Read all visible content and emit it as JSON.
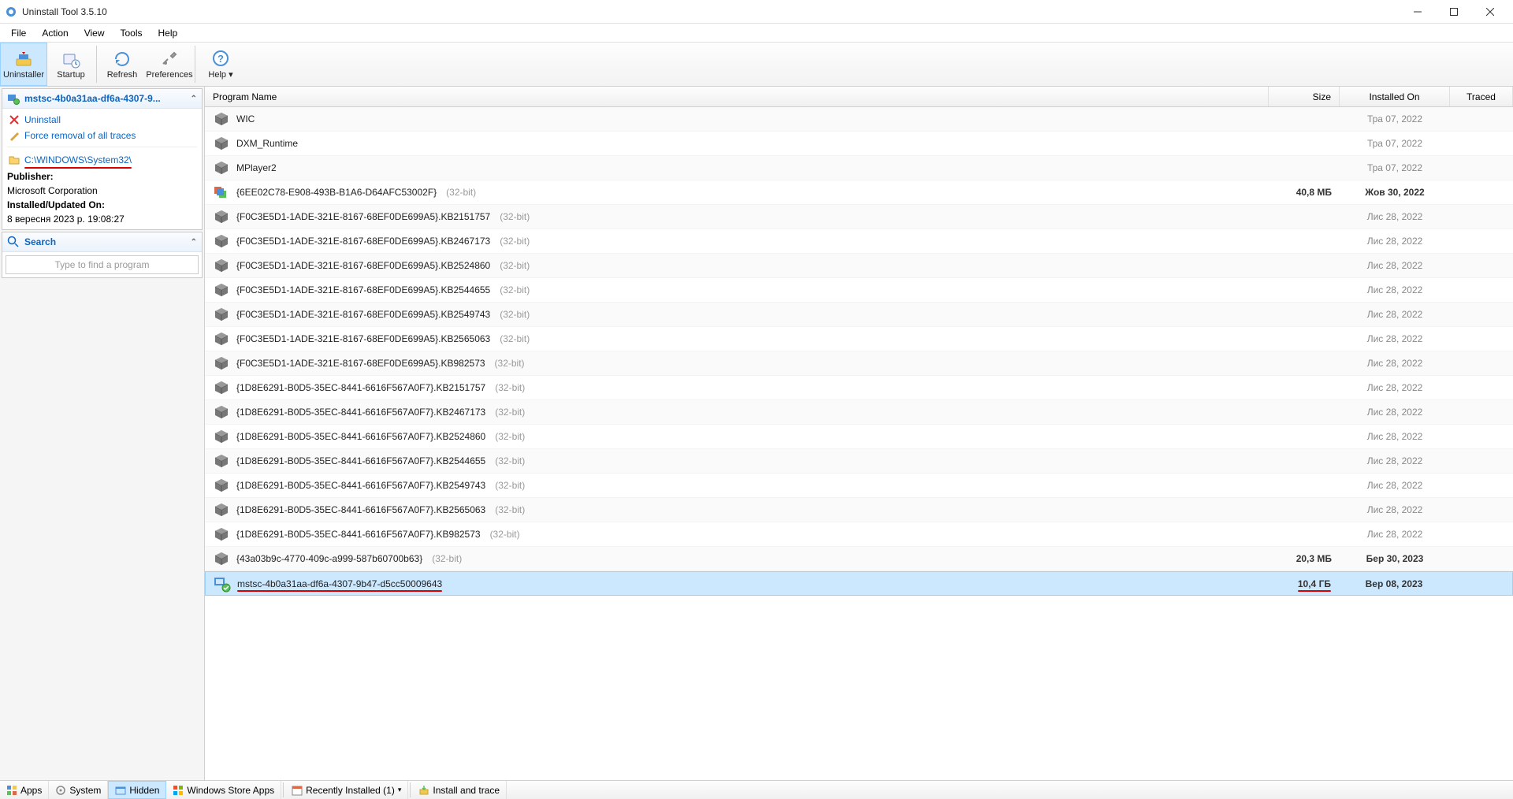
{
  "window": {
    "title": "Uninstall Tool 3.5.10"
  },
  "menu": {
    "file": "File",
    "action": "Action",
    "view": "View",
    "tools": "Tools",
    "help": "Help"
  },
  "toolbar": {
    "uninstaller": "Uninstaller",
    "startup": "Startup",
    "refresh": "Refresh",
    "preferences": "Preferences",
    "help": "Help"
  },
  "sidebar": {
    "selected_title": "mstsc-4b0a31aa-df6a-4307-9...",
    "uninstall_label": "Uninstall",
    "force_removal_label": "Force removal of all traces",
    "path": "C:\\WINDOWS\\System32\\",
    "publisher_label": "Publisher:",
    "publisher_value": "Microsoft Corporation",
    "installed_label": "Installed/Updated On:",
    "installed_value": "8 вересня 2023 р. 19:08:27",
    "search_header": "Search",
    "search_placeholder": "Type to find a program"
  },
  "columns": {
    "name": "Program Name",
    "size": "Size",
    "installed": "Installed On",
    "traced": "Traced"
  },
  "rows": [
    {
      "name": "WIC",
      "arch": "",
      "size": "",
      "installed": "Тра 07, 2022",
      "iconType": "box"
    },
    {
      "name": "DXM_Runtime",
      "arch": "",
      "size": "",
      "installed": "Тра 07, 2022",
      "iconType": "box"
    },
    {
      "name": "MPlayer2",
      "arch": "",
      "size": "",
      "installed": "Тра 07, 2022",
      "iconType": "box"
    },
    {
      "name": "{6EE02C78-E908-493B-B1A6-D64AFC53002F}",
      "arch": "(32-bit)",
      "size": "40,8 МБ",
      "installed": "Жов 30, 2022",
      "iconType": "installer",
      "bold": true
    },
    {
      "name": "{F0C3E5D1-1ADE-321E-8167-68EF0DE699A5}.KB2151757",
      "arch": "(32-bit)",
      "size": "",
      "installed": "Лис 28, 2022",
      "iconType": "box"
    },
    {
      "name": "{F0C3E5D1-1ADE-321E-8167-68EF0DE699A5}.KB2467173",
      "arch": "(32-bit)",
      "size": "",
      "installed": "Лис 28, 2022",
      "iconType": "box"
    },
    {
      "name": "{F0C3E5D1-1ADE-321E-8167-68EF0DE699A5}.KB2524860",
      "arch": "(32-bit)",
      "size": "",
      "installed": "Лис 28, 2022",
      "iconType": "box"
    },
    {
      "name": "{F0C3E5D1-1ADE-321E-8167-68EF0DE699A5}.KB2544655",
      "arch": "(32-bit)",
      "size": "",
      "installed": "Лис 28, 2022",
      "iconType": "box"
    },
    {
      "name": "{F0C3E5D1-1ADE-321E-8167-68EF0DE699A5}.KB2549743",
      "arch": "(32-bit)",
      "size": "",
      "installed": "Лис 28, 2022",
      "iconType": "box"
    },
    {
      "name": "{F0C3E5D1-1ADE-321E-8167-68EF0DE699A5}.KB2565063",
      "arch": "(32-bit)",
      "size": "",
      "installed": "Лис 28, 2022",
      "iconType": "box"
    },
    {
      "name": "{F0C3E5D1-1ADE-321E-8167-68EF0DE699A5}.KB982573",
      "arch": "(32-bit)",
      "size": "",
      "installed": "Лис 28, 2022",
      "iconType": "box"
    },
    {
      "name": "{1D8E6291-B0D5-35EC-8441-6616F567A0F7}.KB2151757",
      "arch": "(32-bit)",
      "size": "",
      "installed": "Лис 28, 2022",
      "iconType": "box"
    },
    {
      "name": "{1D8E6291-B0D5-35EC-8441-6616F567A0F7}.KB2467173",
      "arch": "(32-bit)",
      "size": "",
      "installed": "Лис 28, 2022",
      "iconType": "box"
    },
    {
      "name": "{1D8E6291-B0D5-35EC-8441-6616F567A0F7}.KB2524860",
      "arch": "(32-bit)",
      "size": "",
      "installed": "Лис 28, 2022",
      "iconType": "box"
    },
    {
      "name": "{1D8E6291-B0D5-35EC-8441-6616F567A0F7}.KB2544655",
      "arch": "(32-bit)",
      "size": "",
      "installed": "Лис 28, 2022",
      "iconType": "box"
    },
    {
      "name": "{1D8E6291-B0D5-35EC-8441-6616F567A0F7}.KB2549743",
      "arch": "(32-bit)",
      "size": "",
      "installed": "Лис 28, 2022",
      "iconType": "box"
    },
    {
      "name": "{1D8E6291-B0D5-35EC-8441-6616F567A0F7}.KB2565063",
      "arch": "(32-bit)",
      "size": "",
      "installed": "Лис 28, 2022",
      "iconType": "box"
    },
    {
      "name": "{1D8E6291-B0D5-35EC-8441-6616F567A0F7}.KB982573",
      "arch": "(32-bit)",
      "size": "",
      "installed": "Лис 28, 2022",
      "iconType": "box"
    },
    {
      "name": "{43a03b9c-4770-409c-a999-587b60700b63}",
      "arch": "(32-bit)",
      "size": "20,3 МБ",
      "installed": "Бер 30, 2023",
      "iconType": "box",
      "bold": true
    },
    {
      "name": "mstsc-4b0a31aa-df6a-4307-9b47-d5cc50009643",
      "arch": "",
      "size": "10,4 ГБ",
      "installed": "Вер 08, 2023",
      "iconType": "mstsc",
      "selected": true,
      "underline": true,
      "bold": true
    }
  ],
  "statusbar": {
    "apps": "Apps",
    "system": "System",
    "hidden": "Hidden",
    "store": "Windows Store Apps",
    "recent": "Recently Installed (1)",
    "install_trace": "Install and trace"
  }
}
